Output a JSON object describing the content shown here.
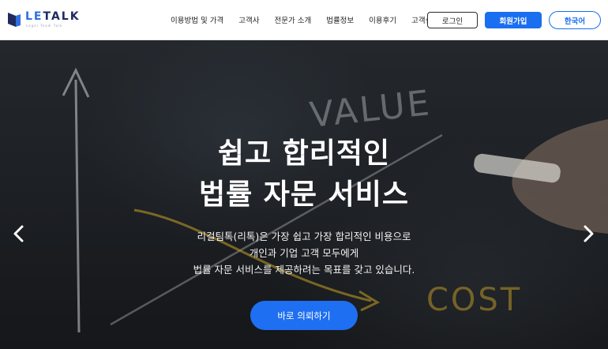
{
  "brand": {
    "name_accent": "LE",
    "name_rest": "TALK",
    "tagline": "Legal Team Talk"
  },
  "nav": {
    "items": [
      "이용방법 및 가격",
      "고객사",
      "전문가 소개",
      "법률정보",
      "이용후기",
      "고객센터"
    ]
  },
  "header_buttons": {
    "login": "로그인",
    "signup": "회원가입",
    "language": "한국어"
  },
  "hero": {
    "title_line1": "쉽고 합리적인",
    "title_line2": "법률 자문 서비스",
    "desc_line1": "리걸팀톡(리톡)은 가장 쉽고 가장 합리적인 비용으로",
    "desc_line2": "개인과 기업 고객 모두에게",
    "desc_line3": "법률 자문 서비스를 제공하려는 목표를 갖고 있습니다.",
    "cta": "바로 의뢰하기",
    "bg_words": {
      "value": "VALUE",
      "cost": "COST"
    }
  },
  "colors": {
    "brand_blue": "#1a6ef0",
    "brand_navy": "#1f2b5e",
    "chalk_yellow": "#c9a227"
  },
  "icons": {
    "prev": "chevron-left-icon",
    "next": "chevron-right-icon"
  }
}
